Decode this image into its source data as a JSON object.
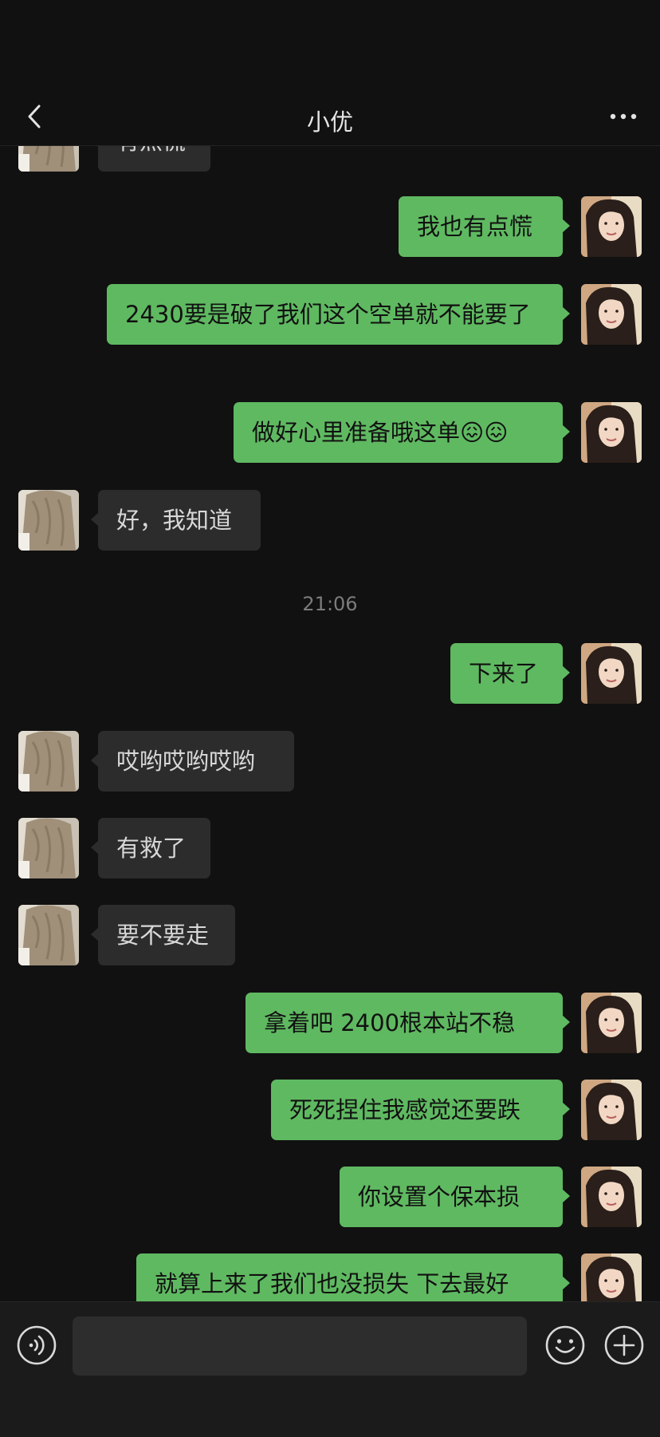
{
  "header": {
    "title": "小优",
    "back_icon": "chevron-left-icon",
    "more_icon": "more-horizontal-icon"
  },
  "colors": {
    "background": "#111111",
    "bubble_self": "#5fb961",
    "bubble_other": "#2c2c2c",
    "timestamp": "#7c7c7c"
  },
  "messages": [
    {
      "sender": "other",
      "text": "有点慌"
    },
    {
      "sender": "me",
      "text": "我也有点慌"
    },
    {
      "sender": "me",
      "text": "2430要是破了我们这个空单就不能要了"
    },
    {
      "sender": "me",
      "text": "做好心里准备哦这单😖😖"
    },
    {
      "sender": "other",
      "text": "好，我知道"
    },
    {
      "time": "21:06"
    },
    {
      "sender": "me",
      "text": "下来了"
    },
    {
      "sender": "other",
      "text": "哎哟哎哟哎哟"
    },
    {
      "sender": "other",
      "text": "有救了"
    },
    {
      "sender": "other",
      "text": "要不要走"
    },
    {
      "sender": "me",
      "text": "拿着吧 2400根本站不稳"
    },
    {
      "sender": "me",
      "text": "死死捏住我感觉还要跌"
    },
    {
      "sender": "me",
      "text": "你设置个保本损"
    },
    {
      "sender": "me",
      "text": "就算上来了我们也没损失 下去最好"
    }
  ],
  "input_bar": {
    "voice_icon": "voice-icon",
    "emoji_icon": "emoji-icon",
    "plus_icon": "plus-circle-icon",
    "text_value": ""
  }
}
